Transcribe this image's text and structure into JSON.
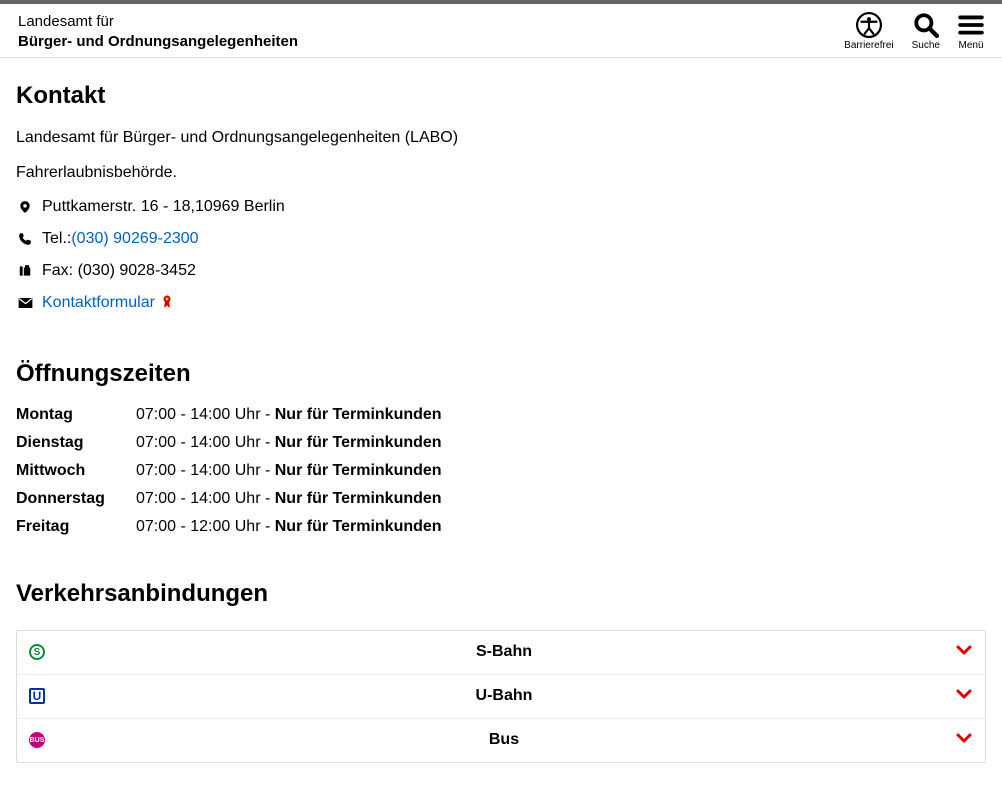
{
  "header": {
    "title_line1": "Landesamt für",
    "title_line2": "Bürger- und Ordnungsangelegenheiten",
    "tools": {
      "accessibility": "Barrierefrei",
      "search": "Suche",
      "menu": "Menü"
    }
  },
  "sections": {
    "contact_heading": "Kontakt",
    "hours_heading": "Öffnungszeiten",
    "transport_heading": "Verkehrsanbindungen"
  },
  "contact": {
    "org": "Landesamt für Bürger- und Ordnungsangelegenheiten (LABO)",
    "dept": "Fahrerlaubnisbehörde.",
    "address": "Puttkamerstr. 16 - 18,10969 Berlin",
    "tel_label": "Tel.:",
    "tel_value": "(030) 90269-2300",
    "fax_label": "Fax: ",
    "fax_value": "(030) 9028-3452",
    "form_link": "Kontaktformular"
  },
  "hours": [
    {
      "day": "Montag",
      "time": "07:00 - 14:00 Uhr - ",
      "note": "Nur für Terminkunden"
    },
    {
      "day": "Dienstag",
      "time": "07:00 - 14:00 Uhr - ",
      "note": "Nur für Terminkunden"
    },
    {
      "day": "Mittwoch",
      "time": "07:00 - 14:00 Uhr - ",
      "note": "Nur für Terminkunden"
    },
    {
      "day": "Donnerstag",
      "time": "07:00 - 14:00 Uhr - ",
      "note": "Nur für Terminkunden"
    },
    {
      "day": "Freitag",
      "time": "07:00 - 12:00 Uhr - ",
      "note": "Nur für Terminkunden"
    }
  ],
  "transport": [
    {
      "kind": "sbahn",
      "glyph": "S",
      "label": "S-Bahn"
    },
    {
      "kind": "ubahn",
      "glyph": "U",
      "label": "U-Bahn"
    },
    {
      "kind": "bus",
      "glyph": "BUS",
      "label": "Bus"
    }
  ]
}
